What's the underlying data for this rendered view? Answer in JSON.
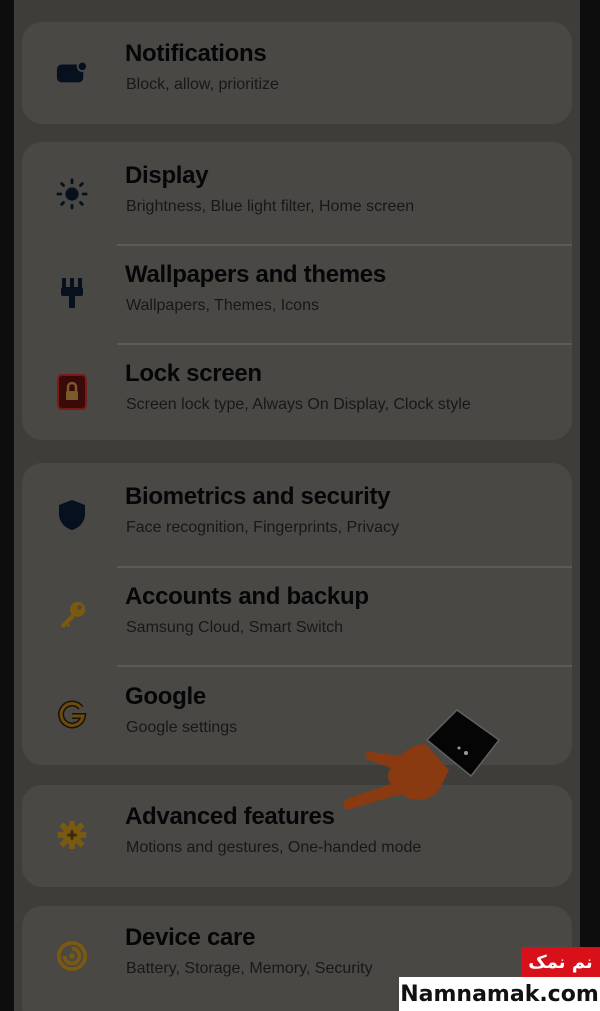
{
  "settings": {
    "items": [
      {
        "title": "Notifications",
        "subtitle": "Block, allow, prioritize",
        "icon": "notifications-icon"
      },
      {
        "title": "Display",
        "subtitle": "Brightness, Blue light filter, Home screen",
        "icon": "brightness-icon"
      },
      {
        "title": "Wallpapers and themes",
        "subtitle": "Wallpapers, Themes, Icons",
        "icon": "paintbrush-icon"
      },
      {
        "title": "Lock screen",
        "subtitle": "Screen lock type, Always On Display, Clock style",
        "icon": "lock-icon"
      },
      {
        "title": "Biometrics and security",
        "subtitle": "Face recognition, Fingerprints, Privacy",
        "icon": "shield-icon"
      },
      {
        "title": "Accounts and backup",
        "subtitle": "Samsung Cloud, Smart Switch",
        "icon": "key-icon"
      },
      {
        "title": "Google",
        "subtitle": "Google settings",
        "icon": "google-icon"
      },
      {
        "title": "Advanced features",
        "subtitle": "Motions and gestures, One-handed mode",
        "icon": "gear-plus-icon"
      },
      {
        "title": "Device care",
        "subtitle": "Battery, Storage, Memory, Security",
        "icon": "device-care-icon"
      }
    ]
  },
  "watermark": {
    "persian": "نم نمک",
    "site": "Namnamak.com"
  },
  "colors": {
    "background": "#3f3d3a",
    "card": "#4a4845",
    "text": "#060608",
    "accent_orange": "#8a3a10",
    "watermark_red": "#d8101a"
  }
}
